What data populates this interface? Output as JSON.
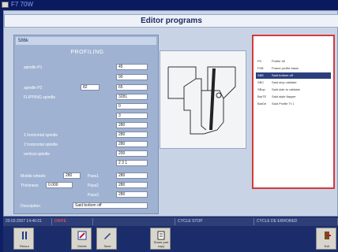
{
  "window": {
    "title": "F7 70W"
  },
  "header": {
    "title": "Editor programs"
  },
  "program": {
    "name": "586k"
  },
  "form": {
    "title": "PROFILING",
    "rows": [
      {
        "label": "spindle P1",
        "value": "45"
      },
      {
        "label": "",
        "value": "90"
      },
      {
        "label": "spindle P2",
        "input": "82",
        "value": "65"
      },
      {
        "label": "FLIPPING spindle",
        "value": "3281"
      },
      {
        "label": "",
        "value": "0"
      },
      {
        "label": "",
        "value": "3"
      },
      {
        "label": "",
        "value": "280"
      },
      {
        "label": "1 horizontal spindle",
        "value": "280"
      },
      {
        "label": "2 horizontal spindle",
        "value": "280"
      },
      {
        "label": "vertical spindle",
        "value": "200"
      },
      {
        "label": "",
        "value": "2 3 1"
      }
    ],
    "mobile_label": "Mobile wheels",
    "mobile_value": "280",
    "thickness_label": "Thickness",
    "thickness_value": "0.000",
    "pass1": "Pass1",
    "pass2": "Pass2",
    "pass3": "Pass3",
    "pass1_value": "280",
    "pass2_value": "280",
    "pass3_value": "280",
    "description_label": "Description",
    "description_value": "Said bottom off"
  },
  "list": {
    "items": [
      {
        "code": "P0",
        "label": "Profile 46"
      },
      {
        "code": "P2B",
        "label": "Frame profile basis"
      },
      {
        "code": "SBE",
        "label": "Said bottom off",
        "selected": true
      },
      {
        "code": "SBC",
        "label": "Said stop validate"
      },
      {
        "code": "SBop",
        "label": "Said side to validate"
      },
      {
        "code": "BarTE",
        "label": "Said style flapper"
      },
      {
        "code": "BarDe",
        "label": "Said Profile Tt 1"
      }
    ]
  },
  "status": {
    "seg1": "20.03.2007 14:46:01",
    "seg2": "DRIFE",
    "seg3": "",
    "seg4": "CYCLE STOP",
    "seg5": "CYCLE DE ERRORED"
  },
  "toolbar": {
    "btn1": "Retour",
    "btn2": "Delete",
    "btn3": "Save",
    "btn4": "Share part copy",
    "btn5": "Exit"
  }
}
